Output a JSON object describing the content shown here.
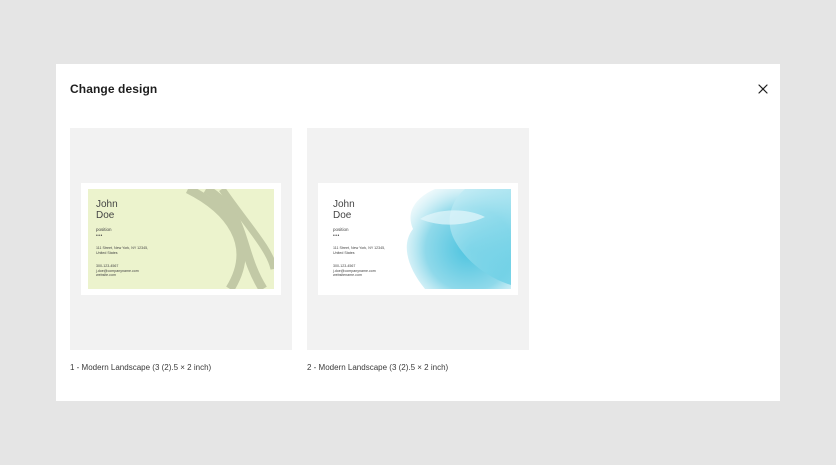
{
  "dialog": {
    "title": "Change design",
    "close_icon": "close-icon"
  },
  "designs": [
    {
      "caption": "1 - Modern Landscape (3 (2).5 × 2 inch)",
      "accent": "#ecf3cd",
      "card": {
        "name_first": "John",
        "name_last": "Doe",
        "position": "position",
        "dots": "•••",
        "address_line1": "111 Street, New York, NY 12345,",
        "address_line2": "United States",
        "phone": "300-123-4567",
        "email": "j.doe@companyname.com",
        "website": "website.com"
      }
    },
    {
      "caption": "2 - Modern Landscape (3 (2).5 × 2 inch)",
      "accent": "#5cc9e0",
      "card": {
        "name_first": "John",
        "name_last": "Doe",
        "position": "position",
        "dots": "•••",
        "address_line1": "111 Street, New York, NY 12345,",
        "address_line2": "United States",
        "phone": "300-123-4567",
        "email": "j.doe@companyname.com",
        "website": "websitename.com"
      }
    }
  ]
}
